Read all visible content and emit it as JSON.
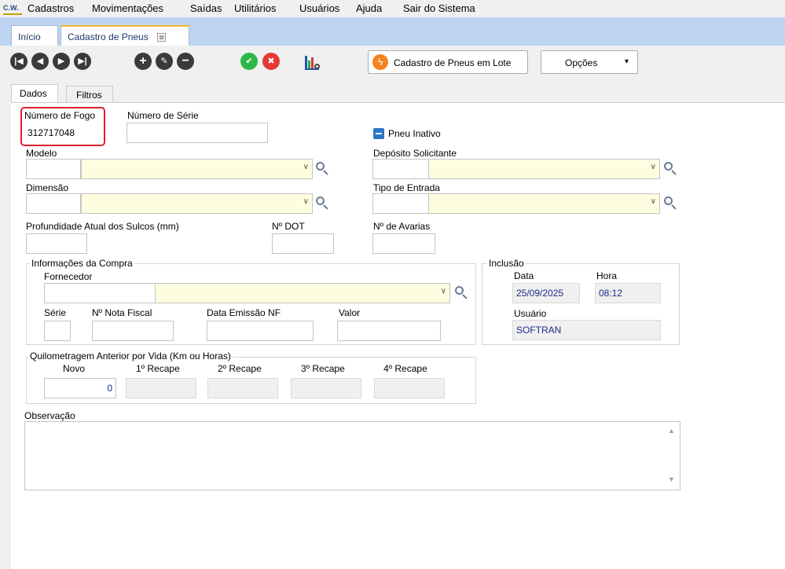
{
  "menu": {
    "logo_text": "C.W.",
    "items": [
      "Cadastros",
      "Movimentações",
      "Saídas",
      "Utilitários",
      "Usuários",
      "Ajuda",
      "Sair do Sistema"
    ]
  },
  "tabs": {
    "home": "Início",
    "active": "Cadastro de Pneus",
    "close_glyph": "⊠"
  },
  "toolbar": {
    "first_icon": "first-record-icon",
    "prev_icon": "previous-record-icon",
    "next_icon": "next-record-icon",
    "last_icon": "last-record-icon",
    "add_icon": "add-icon",
    "edit_icon": "edit-icon",
    "remove_icon": "remove-icon",
    "confirm_icon": "confirm-icon",
    "cancel_icon": "cancel-icon",
    "report_icon": "report-chart-icon",
    "batch_label": "Cadastro de Pneus em Lote",
    "options_label": "Opções",
    "options_arrow": "▾"
  },
  "form_tabs": {
    "dados": "Dados",
    "filtros": "Filtros"
  },
  "form": {
    "numero_fogo_label": "Número de Fogo",
    "numero_fogo_value": "312717048",
    "numero_serie_label": "Número de Série",
    "numero_serie_value": "",
    "pneu_inativo_label": "Pneu Inativo",
    "modelo_label": "Modelo",
    "deposito_label": "Depósito Solicitante",
    "dimensao_label": "Dimensão",
    "tipo_entrada_label": "Tipo de Entrada",
    "profundidade_label": "Profundidade Atual dos Sulcos (mm)",
    "dot_label": "Nº DOT",
    "avarias_label": "Nº de Avarias",
    "combo_arrow": "∨"
  },
  "compra": {
    "title": "Informações da Compra",
    "fornecedor_label": "Fornecedor",
    "serie_label": "Série",
    "nota_label": "Nº Nota Fiscal",
    "emissao_label": "Data Emissão NF",
    "valor_label": "Valor"
  },
  "inclusao": {
    "title": "Inclusão",
    "data_label": "Data",
    "data_value": "25/09/2025",
    "hora_label": "Hora",
    "hora_value": "08:12",
    "usuario_label": "Usuário",
    "usuario_value": "SOFTRAN"
  },
  "quilometragem": {
    "title": "Quilometragem Anterior por Vida (Km ou Horas)",
    "novo_label": "Novo",
    "novo_value": "0",
    "recape1_label": "1º Recape",
    "recape2_label": "2º Recape",
    "recape3_label": "3º Recape",
    "recape4_label": "4º Recape"
  },
  "observacao": {
    "label": "Observação",
    "value": "",
    "scroll_up": "▲",
    "scroll_down": "▼"
  }
}
